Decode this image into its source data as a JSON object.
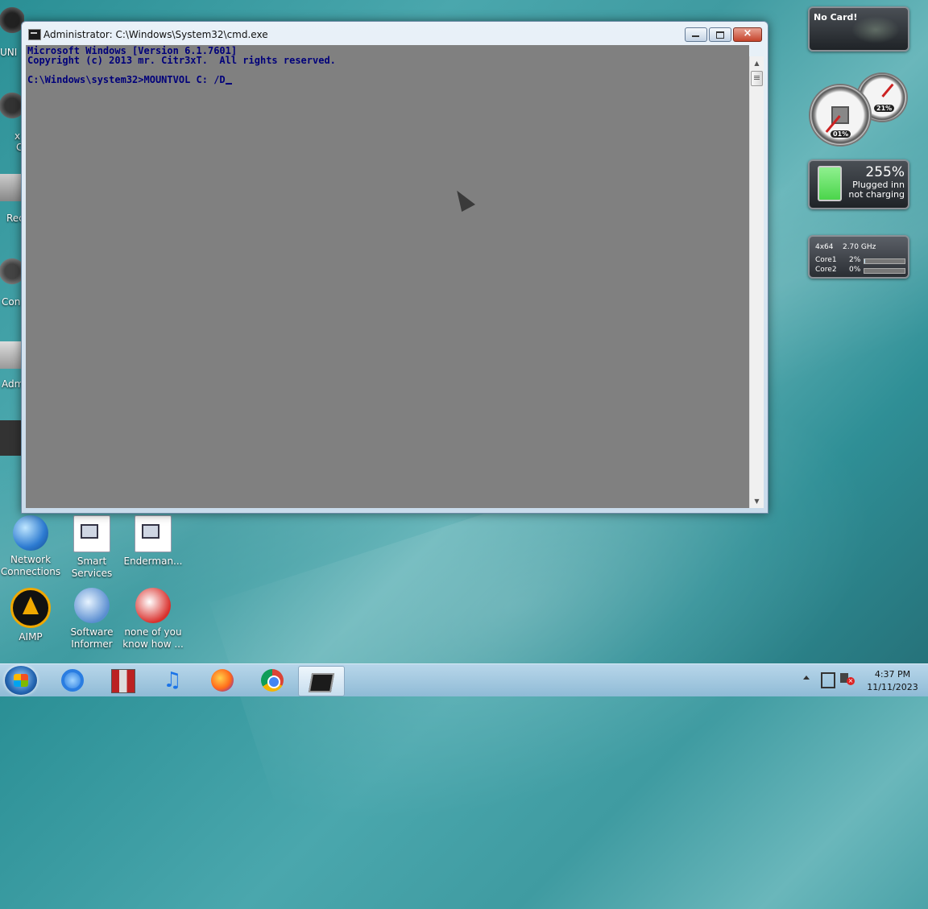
{
  "window": {
    "title": "Administrator: C:\\Windows\\System32\\cmd.exe",
    "close_glyph": "×"
  },
  "console": {
    "lines": [
      "Microsoft Windows [Version 6.1.7601]",
      "Copyright (c) 2013 mr. Citr3xT.  All rights reserved.",
      "",
      "C:\\Windows\\system32>MOUNTVOL C: /D"
    ]
  },
  "desktop_icons": [
    {
      "label_line1": "Network",
      "label_line2": "Connections"
    },
    {
      "label_line1": "Smart",
      "label_line2": "Services"
    },
    {
      "label_line1": "Enderman...",
      "label_line2": ""
    },
    {
      "label_line1": "AIMP",
      "label_line2": ""
    },
    {
      "label_line1": "Software",
      "label_line2": "Informer"
    },
    {
      "label_line1": "none of you",
      "label_line2": "know how ..."
    }
  ],
  "left_clipped_labels": [
    "UNI",
    "x",
    "C",
    "Rec",
    "Con",
    "Adm"
  ],
  "gadgets": {
    "gpu": {
      "label": "No Card!"
    },
    "meters": {
      "cpu_pct": "01%",
      "mem_pct": "21%"
    },
    "battery": {
      "percent": "255%",
      "status1": "Plugged inn",
      "status2": "not charging"
    },
    "cpu": {
      "arch": "4x64",
      "freq": "2.70 GHz",
      "cores": [
        {
          "name": "Core1",
          "pct": "2%",
          "fill": 0.02
        },
        {
          "name": "Core2",
          "pct": "0%",
          "fill": 0.0
        }
      ]
    }
  },
  "taskbar": {
    "time": "4:37 PM",
    "date": "11/11/2023"
  },
  "colors": {
    "console_bg": "#808080",
    "console_text": "#00007a",
    "desktop_teal": "#3f9ba1"
  }
}
